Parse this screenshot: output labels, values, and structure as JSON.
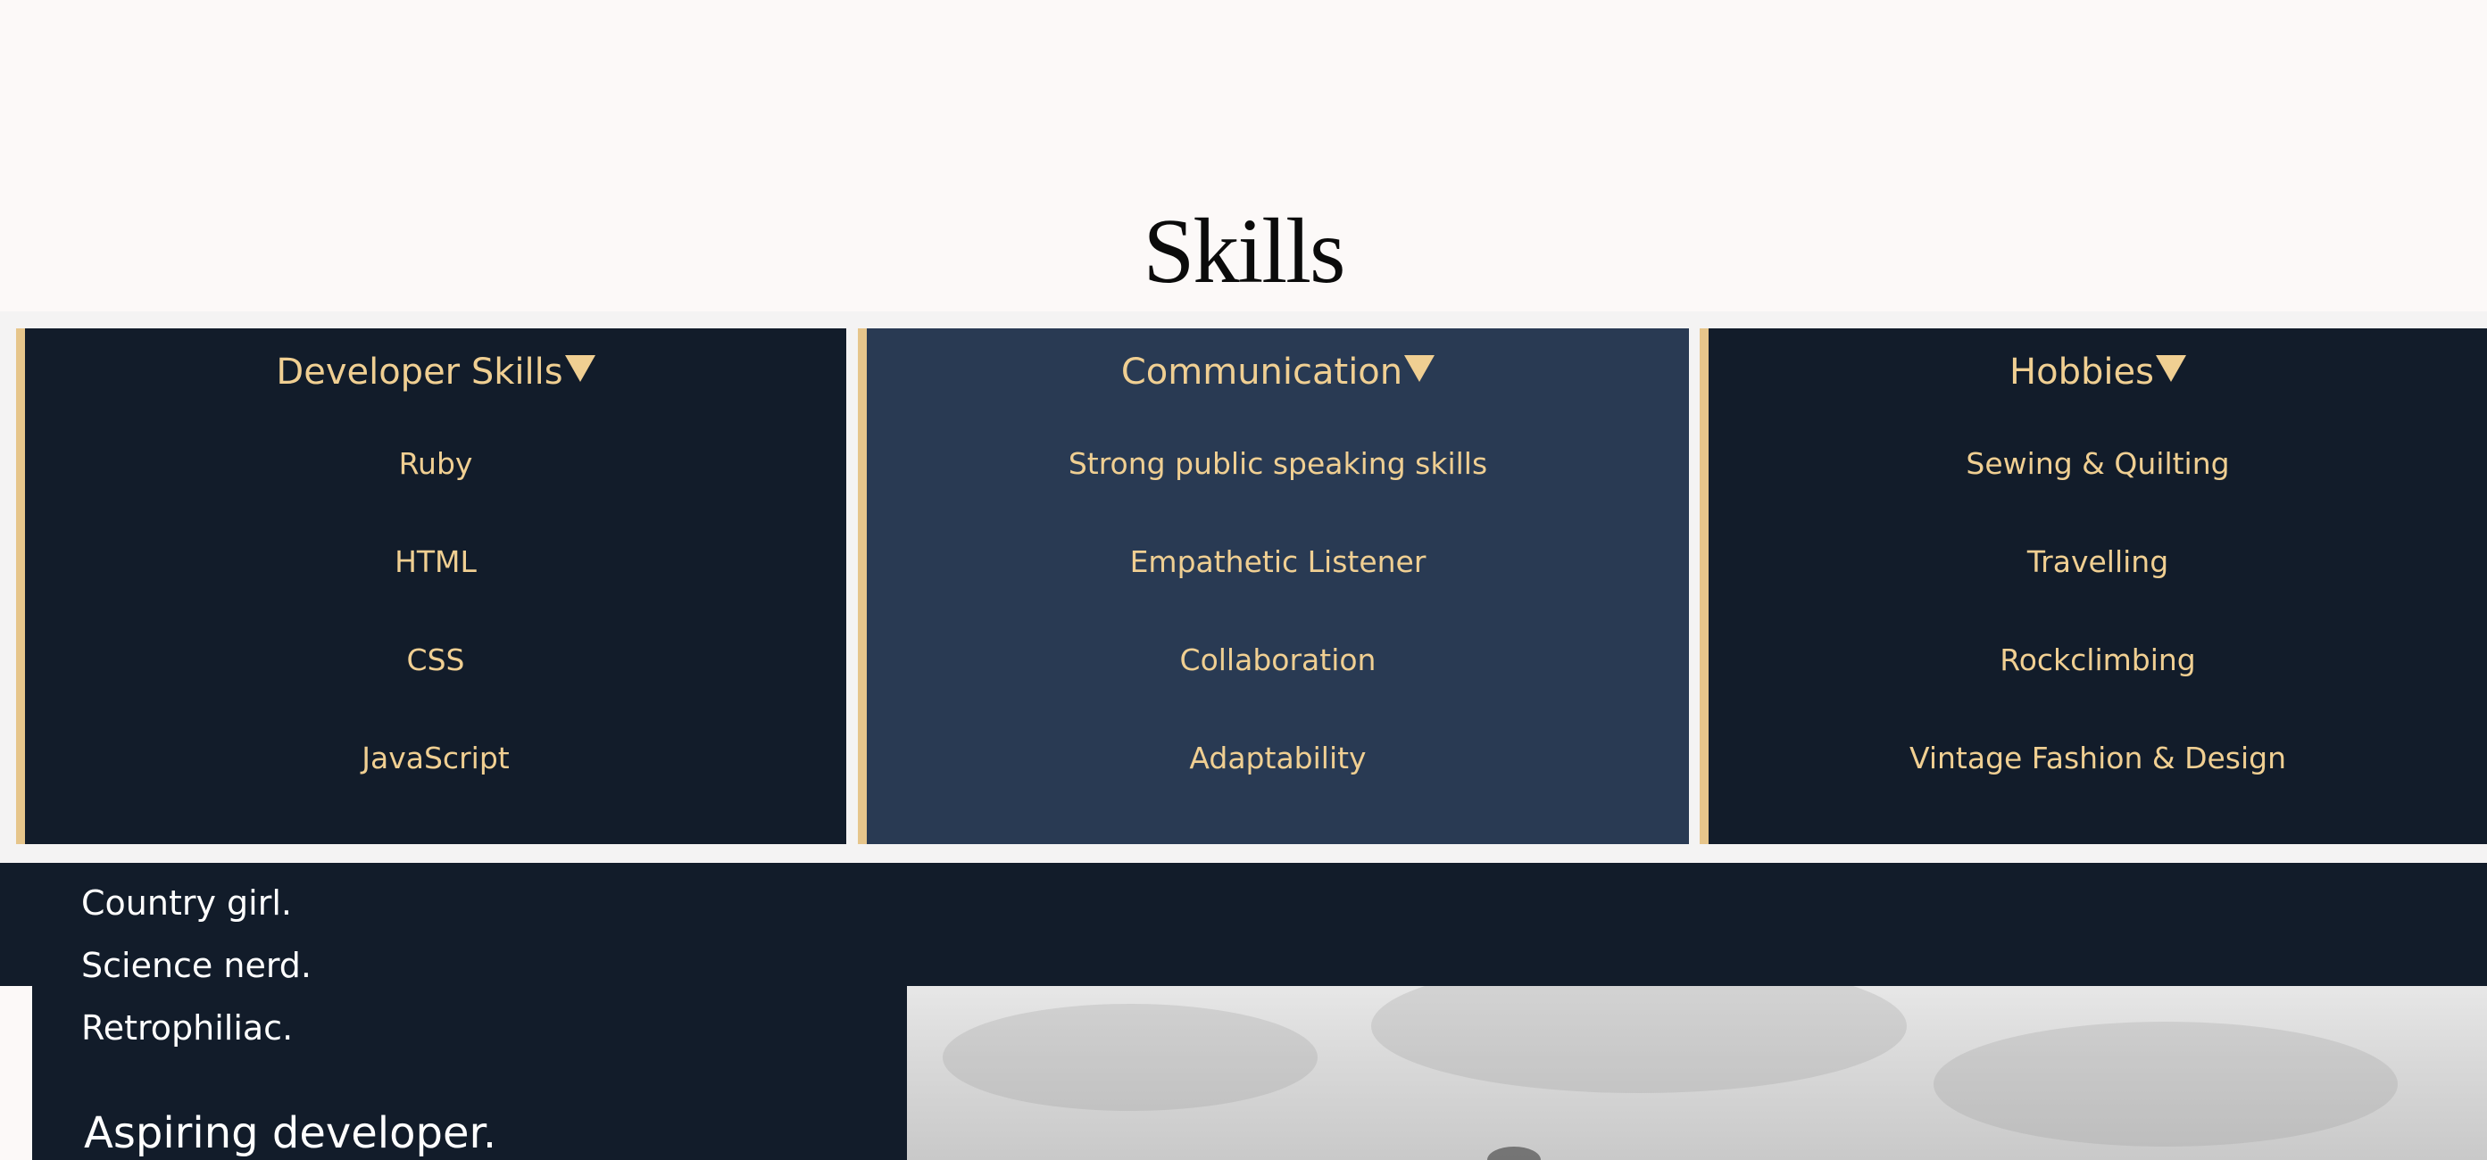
{
  "section_title": "Skills",
  "columns": [
    {
      "title": "Developer Skills",
      "items": [
        "Ruby",
        "HTML",
        "CSS",
        "JavaScript"
      ]
    },
    {
      "title": "Communication",
      "items": [
        "Strong public speaking skills",
        "Empathetic Listener",
        "Collaboration",
        "Adaptability"
      ]
    },
    {
      "title": "Hobbies",
      "items": [
        "Sewing & Quilting",
        "Travelling",
        "Rockclimbing",
        "Vintage Fashion & Design"
      ]
    }
  ],
  "about": {
    "lines": [
      "Country girl.",
      "Science nerd.",
      "Retrophiliac."
    ],
    "headline": "Aspiring developer."
  },
  "icons": {
    "column_toggle": "caret-down-icon"
  },
  "colors": {
    "page_bg": "#fcf9f8",
    "navy_dark": "#121c2a",
    "navy_mid": "#293a53",
    "gold": "#f0cf92",
    "accent_border": "#e6c58b"
  }
}
